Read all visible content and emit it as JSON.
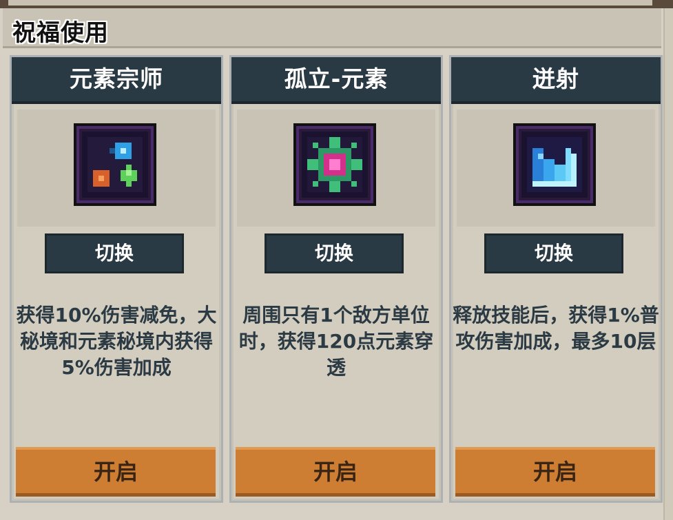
{
  "panel": {
    "title": "祝福使用"
  },
  "cards": [
    {
      "title": "元素宗师",
      "icon": "element-orbs-icon",
      "switch_label": "切换",
      "description": "获得10%伤害减免，大秘境和元素秘境内获得5%伤害加成",
      "open_label": "开启"
    },
    {
      "title": "孤立-元素",
      "icon": "isolated-element-gem-icon",
      "switch_label": "切换",
      "description": "周围只有1个敌方单位时，获得120点元素穿透",
      "open_label": "开启"
    },
    {
      "title": "迸射",
      "icon": "burst-shard-icon",
      "switch_label": "切换",
      "description": "释放技能后，获得1%普攻伤害加成，最多10层",
      "open_label": "开启"
    }
  ]
}
